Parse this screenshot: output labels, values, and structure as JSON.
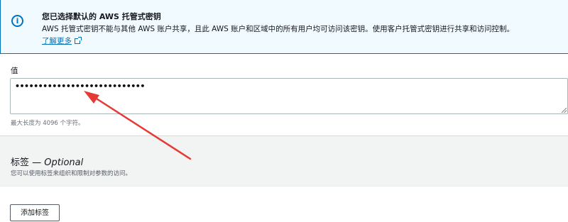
{
  "info": {
    "icon": "info-circle-icon",
    "title": "您已选择默认的 AWS 托管式密钥",
    "body": "AWS 托管式密钥不能与其他 AWS 账户共享，且此 AWS 账户和区域中的所有用户均可访问该密钥。使用客户托管式密钥进行共享和访问控制。",
    "learn_more": "了解更多",
    "accent_color": "#0073bb",
    "background_color": "#f1faff"
  },
  "value_field": {
    "label": "值",
    "masked_value": "••••••••••••••••••••••••••••",
    "hint": "最大长度为 4096 个字符。"
  },
  "tags": {
    "title": "标签",
    "optional": "— Optional",
    "description": "您可以使用标签来组织和限制对参数的访问。",
    "add_button": "添加标签"
  },
  "annotation": {
    "arrow_color": "#e53935"
  }
}
